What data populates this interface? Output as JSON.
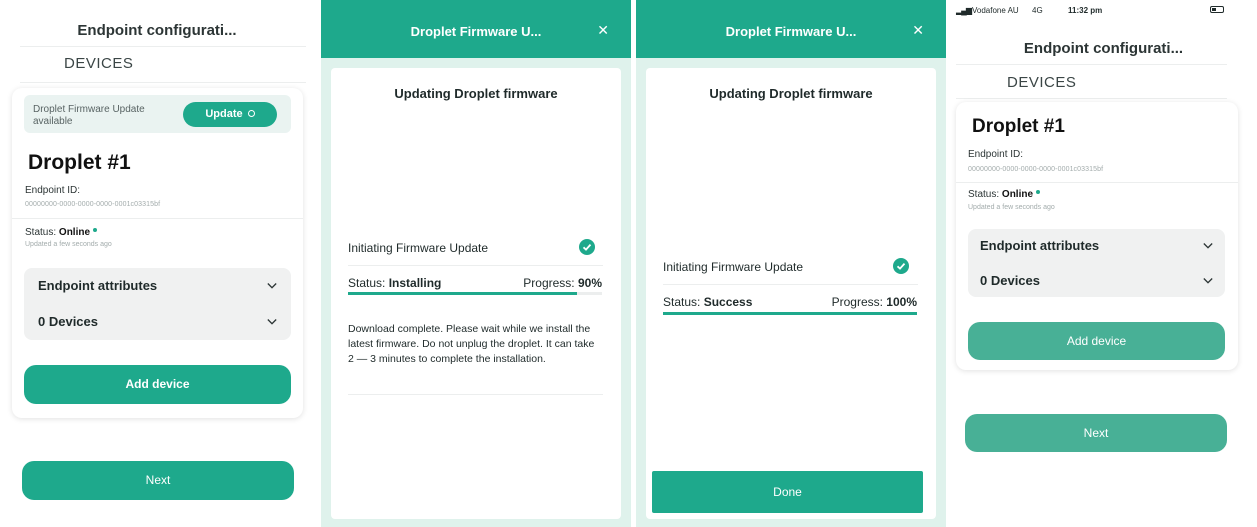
{
  "colors": {
    "accent": "#1ea98c",
    "modal_bg": "#dff2ec",
    "gray_box": "#f0f1f1"
  },
  "screen1": {
    "nav_title": "Endpoint configurati...",
    "devices_tab": "DEVICES",
    "banner_text": "Droplet Firmware Update available",
    "update_button": "Update",
    "droplet_name": "Droplet #1",
    "endpoint_id_label": "Endpoint ID:",
    "endpoint_id": "00000000-0000-0000-0000-0001c03315bf",
    "status_label": "Status:",
    "status_value": "Online",
    "updated_text": "Updated a few seconds ago",
    "endpoint_attributes": "Endpoint attributes",
    "devices_count": "0 Devices",
    "add_device": "Add device",
    "next": "Next"
  },
  "screen2": {
    "title": "Droplet Firmware U...",
    "close_icon": "close-icon",
    "heading": "Updating Droplet firmware",
    "step": "Initiating Firmware Update",
    "status_label": "Status:",
    "status_value": "Installing",
    "progress_label": "Progress:",
    "progress_value": "90%",
    "progress_fraction": 0.9,
    "description": "Download complete. Please wait while we install the latest firmware. Do not unplug the droplet. It can take 2 — 3 minutes to complete the installation."
  },
  "screen3": {
    "title": "Droplet Firmware U...",
    "close_icon": "close-icon",
    "heading": "Updating Droplet firmware",
    "step": "Initiating Firmware Update",
    "status_label": "Status:",
    "status_value": "Success",
    "progress_label": "Progress:",
    "progress_value": "100%",
    "progress_fraction": 1.0,
    "done": "Done"
  },
  "screen4": {
    "carrier": "Vodafone AU",
    "network": "4G",
    "time": "11:32 pm",
    "nav_title": "Endpoint configurati...",
    "devices_tab": "DEVICES",
    "droplet_name": "Droplet #1",
    "endpoint_id_label": "Endpoint ID:",
    "endpoint_id": "00000000-0000-0000-0000-0001c03315bf",
    "status_label": "Status:",
    "status_value": "Online",
    "updated_text": "Updated a few seconds ago",
    "endpoint_attributes": "Endpoint attributes",
    "devices_count": "0 Devices",
    "add_device": "Add device",
    "next": "Next"
  }
}
